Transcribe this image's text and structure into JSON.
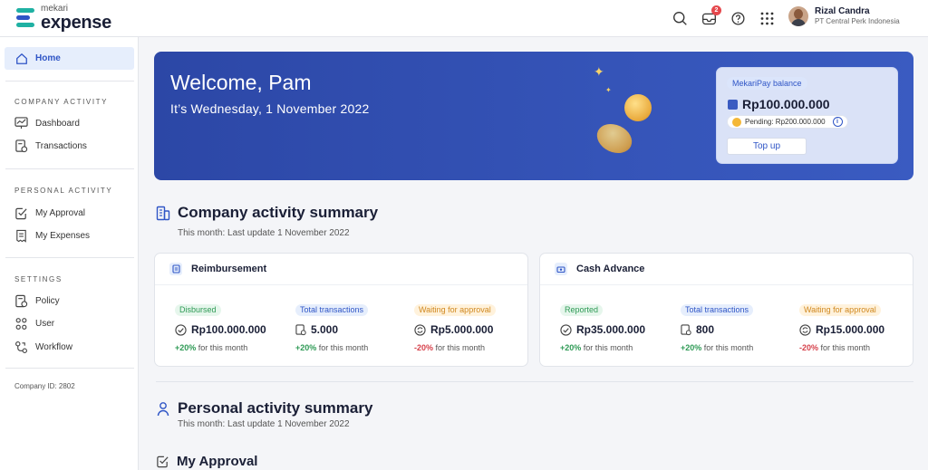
{
  "header": {
    "logo_small": "mekari",
    "logo_big": "expense",
    "notification_count": "2",
    "user_name": "Rizal Candra",
    "user_company": "PT Central Perk Indonesia",
    "icons": [
      "search-icon",
      "inbox-icon",
      "help-icon",
      "apps-grid-icon"
    ]
  },
  "sidebar": {
    "home": "Home",
    "company_title": "COMPANY ACTIVITY",
    "company_items": [
      "Dashboard",
      "Transactions"
    ],
    "personal_title": "PERSONAL ACTIVITY",
    "personal_items": [
      "My Approval",
      "My Expenses"
    ],
    "settings_title": "SETTINGS",
    "settings_items": [
      "Policy",
      "User",
      "Workflow"
    ],
    "company_id": "Company ID: 2802"
  },
  "banner": {
    "title": "Welcome, Pam",
    "subtitle": "It’s Wednesday, 1 November 2022",
    "pay_label": "MekariPay balance",
    "pay_amount": "Rp100.000.000",
    "pending": "Pending: Rp200.000.000",
    "topup": "Top up"
  },
  "company_summary": {
    "title": "Company activity summary",
    "subtitle": "This month: Last update 1 November 2022",
    "cards": [
      {
        "title": "Reimbursement",
        "metrics": [
          {
            "label": "Disbursed",
            "value": "Rp100.000.000",
            "trend": "+20%",
            "trend_text": " for this month"
          },
          {
            "label": "Total transactions",
            "value": "5.000",
            "trend": "+20%",
            "trend_text": " for this month"
          },
          {
            "label": "Waiting for approval",
            "value": "Rp5.000.000",
            "trend": "-20%",
            "trend_text": " for this month"
          }
        ]
      },
      {
        "title": "Cash Advance",
        "metrics": [
          {
            "label": "Reported",
            "value": "Rp35.000.000",
            "trend": "+20%",
            "trend_text": " for this month"
          },
          {
            "label": "Total transactions",
            "value": "800",
            "trend": "+20%",
            "trend_text": " for this month"
          },
          {
            "label": "Waiting for approval",
            "value": "Rp15.000.000",
            "trend": "-20%",
            "trend_text": " for this month"
          }
        ]
      }
    ]
  },
  "personal_summary": {
    "title": "Personal activity summary",
    "subtitle": "This month: Last update 1 November 2022",
    "my_approval": "My Approval"
  },
  "colors": {
    "primary": "#2f55c6",
    "banner": "#3554b8",
    "positive": "#2e9a55",
    "negative": "#d6404a"
  }
}
